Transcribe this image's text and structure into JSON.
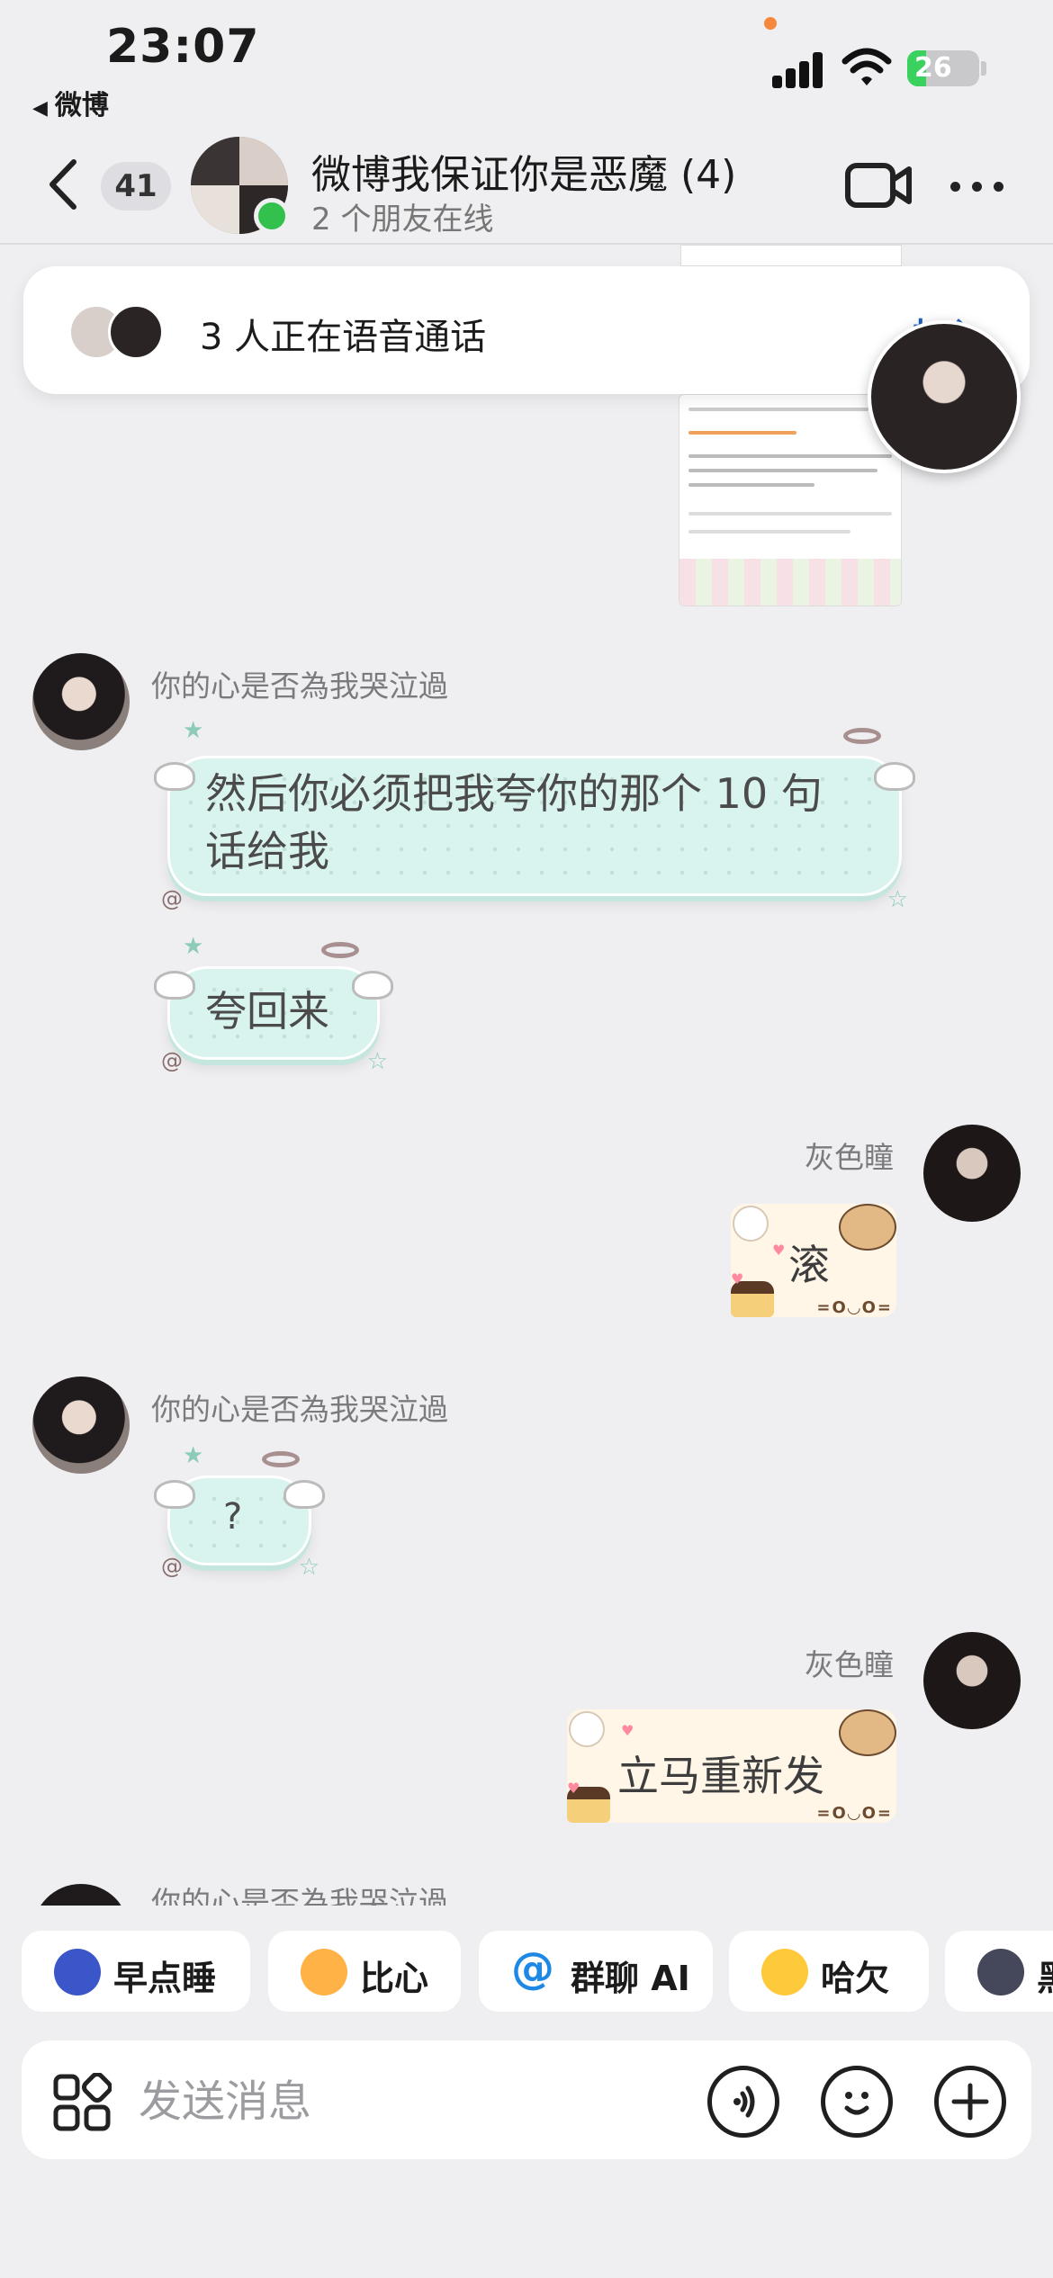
{
  "status_bar": {
    "time": "23:07",
    "back_app": "微博",
    "battery": "26",
    "battery_level": 0.26
  },
  "header": {
    "unread_count": "41",
    "title": "微博我保证你是恶魔 (4)",
    "subtitle": "2 个朋友在线"
  },
  "call_banner": {
    "text": "3 人正在语音通话",
    "join_label": "加入"
  },
  "messages": [
    {
      "sender": "你的心是否為我哭泣過",
      "lines": [
        "然后你必须把我夸你的那个 10 句",
        "话给我"
      ]
    },
    {
      "text": "夸回来"
    },
    {
      "sender": "灰色瞳",
      "text": "滚",
      "face": "=O◡O="
    },
    {
      "sender": "你的心是否為我哭泣過",
      "text": "?"
    },
    {
      "sender": "灰色瞳",
      "text": "立马重新发",
      "face": "=O◡O="
    },
    {
      "sender": "你的心是否為我哭泣過"
    }
  ],
  "quick_replies": [
    {
      "label": "早点睡",
      "icon": "moon-icon",
      "color": "#3b56c9"
    },
    {
      "label": "比心",
      "icon": "heart-hand-icon",
      "color": "#ffb347"
    },
    {
      "label": "群聊 AI",
      "icon": "at-icon",
      "color": "#1e88e5"
    },
    {
      "label": "哈欠",
      "icon": "yawn-emoji-icon",
      "color": "#ffc93c"
    },
    {
      "label": "黑",
      "icon": "dark-face-icon",
      "color": "#45475a"
    }
  ],
  "input": {
    "placeholder": "发送消息"
  },
  "colors": {
    "background": "#efeff1",
    "online": "#33c14d",
    "join": "#1c5fbf",
    "cloud_bubble": "#d9f4ee",
    "bear_bubble": "#fff6e8"
  }
}
